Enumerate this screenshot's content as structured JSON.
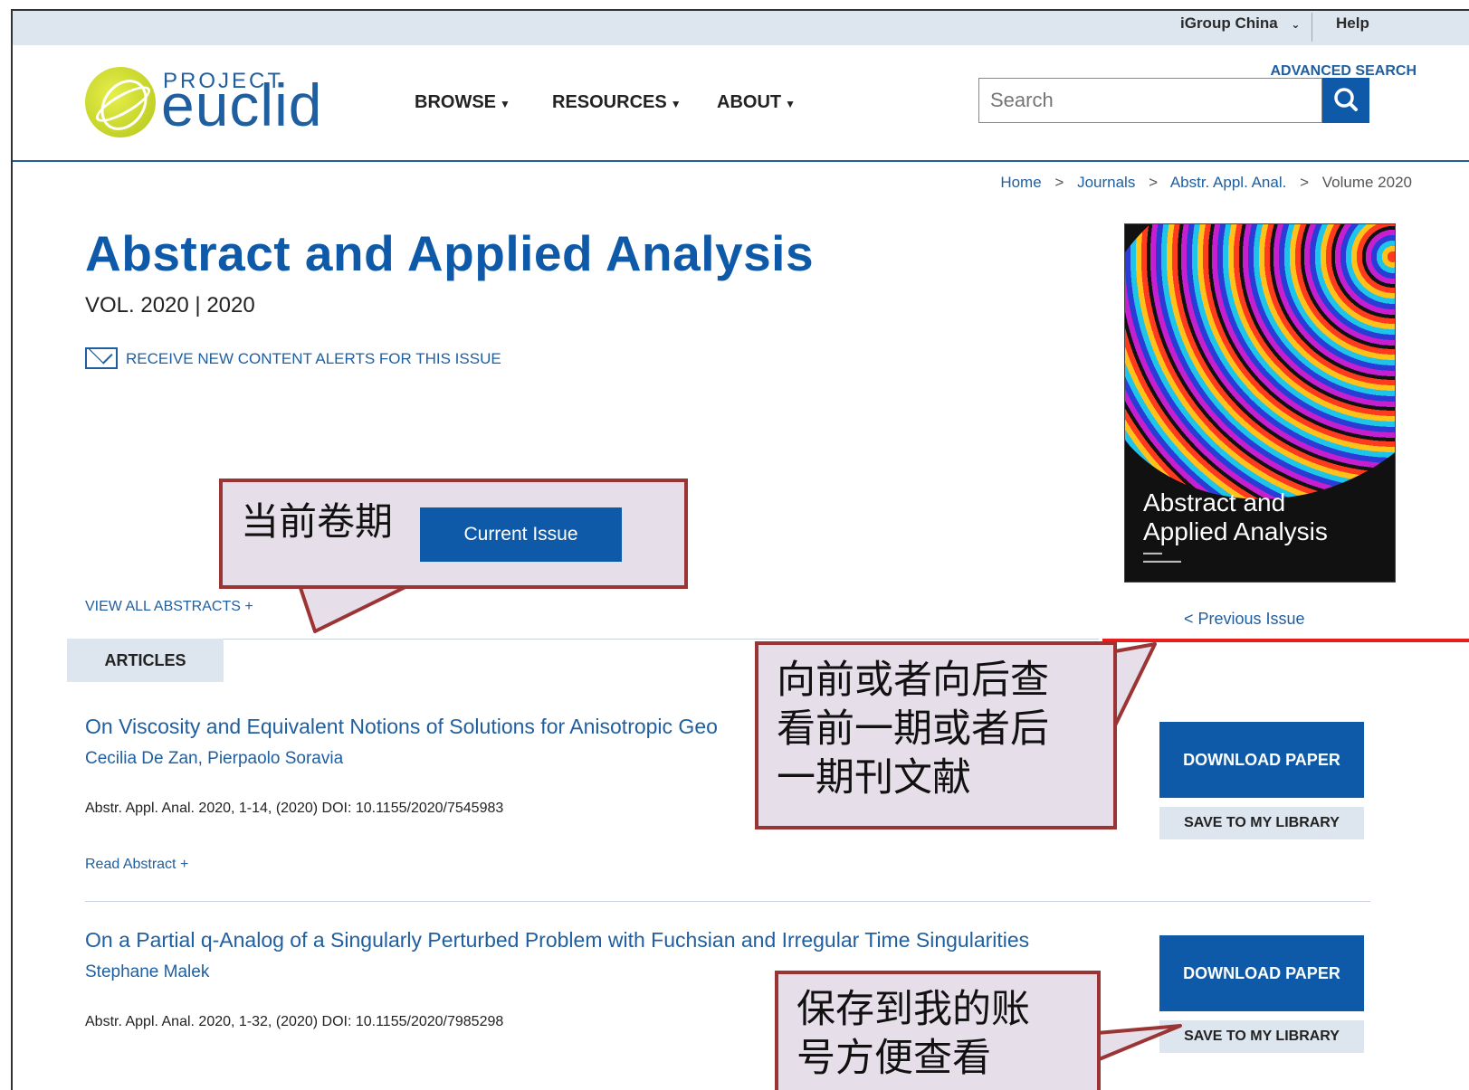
{
  "utility": {
    "region": "iGroup China",
    "help": "Help"
  },
  "header": {
    "logo_top": "PROJECT",
    "logo_main": "euclid",
    "nav": [
      {
        "label": "BROWSE"
      },
      {
        "label": "RESOURCES"
      },
      {
        "label": "ABOUT"
      }
    ],
    "advanced_search": "ADVANCED SEARCH",
    "search_placeholder": "Search"
  },
  "breadcrumb": {
    "home": "Home",
    "journals": "Journals",
    "journal_abbr": "Abstr. Appl. Anal.",
    "volume": "Volume 2020",
    "sep": ">"
  },
  "journal": {
    "title": "Abstract and Applied Analysis",
    "volume_line": "VOL. 2020 | 2020",
    "alert_text": "RECEIVE NEW CONTENT ALERTS FOR THIS ISSUE",
    "cover_title_1": "Abstract and",
    "cover_title_2": "Applied Analysis",
    "previous_issue": "< Previous Issue",
    "view_all_abstracts": "VIEW ALL ABSTRACTS  +"
  },
  "tabs": {
    "articles": "ARTICLES"
  },
  "articles": [
    {
      "title": "On Viscosity and Equivalent Notions of Solutions for Anisotropic Geo",
      "authors": "Cecilia De Zan, Pierpaolo Soravia",
      "meta": "Abstr. Appl. Anal. 2020, 1-14, (2020) DOI: 10.1155/2020/7545983",
      "read_abstract": "Read Abstract +",
      "download": "DOWNLOAD PAPER",
      "save": "SAVE TO MY LIBRARY"
    },
    {
      "title": "On a Partial q-Analog of a Singularly Perturbed Problem with Fuchsian and Irregular Time Singularities",
      "authors": "Stephane Malek",
      "meta": "Abstr. Appl. Anal. 2020, 1-32, (2020) DOI: 10.1155/2020/7985298",
      "download": "DOWNLOAD PAPER",
      "save": "SAVE TO MY LIBRARY"
    }
  ],
  "callouts": {
    "current_issue_label": "当前卷期",
    "current_issue_button": "Current Issue",
    "prev_next_line1": "向前或者向后查",
    "prev_next_line2": "看前一期或者后",
    "prev_next_line3": "一期刊文献",
    "save_line1": "保存到我的账",
    "save_line2": "号方便查看"
  },
  "colors": {
    "primary": "#0f5aa8",
    "callout_border": "#9b3535",
    "callout_bg": "#e6dfea",
    "highlight": "#e81d1d"
  }
}
